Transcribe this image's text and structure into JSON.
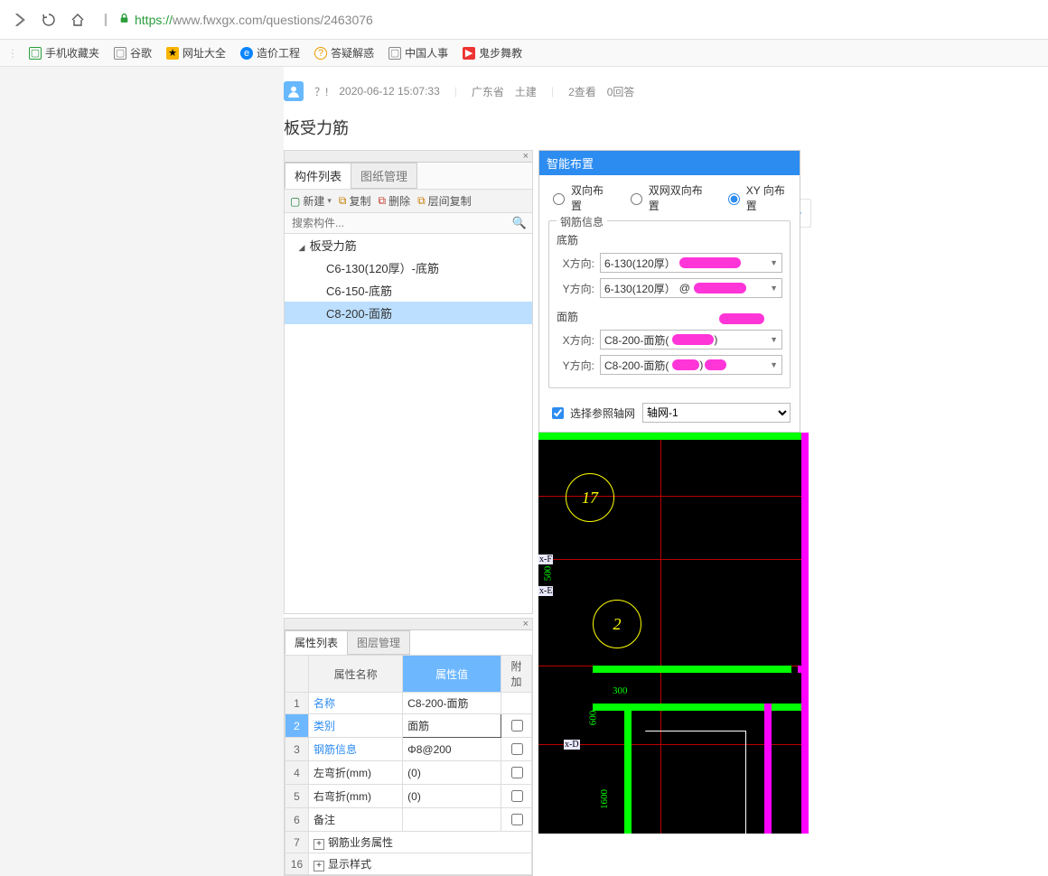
{
  "url": {
    "https": "https://",
    "rest": "www.fwxgx.com/questions/2463076"
  },
  "bookmarks": [
    {
      "label": "手机收藏夹",
      "icon": "phone"
    },
    {
      "label": "谷歌",
      "icon": "page"
    },
    {
      "label": "网址大全",
      "icon": "orange"
    },
    {
      "label": "造价工程",
      "icon": "blue"
    },
    {
      "label": "答疑解惑",
      "icon": "q"
    },
    {
      "label": "中国人事",
      "icon": "page"
    },
    {
      "label": "鬼步舞教",
      "icon": "red"
    }
  ],
  "post": {
    "author": "？!",
    "time": "2020-06-12 15:07:33",
    "region": "广东省",
    "category": "土建",
    "views": "2查看",
    "answers": "0回答",
    "title": "板受力筋"
  },
  "left_panel": {
    "tab1": "构件列表",
    "tab2": "图纸管理",
    "btn_new": "新建",
    "btn_copy": "复制",
    "btn_delete": "删除",
    "btn_level": "层间复制",
    "search_placeholder": "搜索构件...",
    "tree_root": "板受力筋",
    "items": [
      "C6-130(120厚）-底筋",
      "C6-150-底筋",
      "C8-200-面筋"
    ]
  },
  "smart_panel": {
    "title": "智能布置",
    "opt1": "双向布置",
    "opt2": "双网双向布置",
    "opt3": "XY 向布置",
    "legend": "钢筋信息",
    "sect_bottom": "底筋",
    "sect_top": "面筋",
    "lab_x": "X方向:",
    "lab_y": "Y方向:",
    "bottom_x": "6-130(120厚）",
    "bottom_y": "6-130(120厚）",
    "top_x": "C8-200-面筋(",
    "top_y": "C8-200-面筋(",
    "ref_grid_label": "选择参照轴网",
    "ref_grid_value": "轴网-1"
  },
  "prop_panel": {
    "tab1": "属性列表",
    "tab2": "图层管理",
    "col_name": "属性名称",
    "col_value": "属性值",
    "col_extra": "附加",
    "rows": [
      {
        "idx": "1",
        "name": "名称",
        "value": "C8-200-面筋",
        "link": true
      },
      {
        "idx": "2",
        "name": "类别",
        "value": "面筋",
        "link": true,
        "sel": true
      },
      {
        "idx": "3",
        "name": "钢筋信息",
        "value": "Φ8@200",
        "link": true
      },
      {
        "idx": "4",
        "name": "左弯折(mm)",
        "value": "(0)"
      },
      {
        "idx": "5",
        "name": "右弯折(mm)",
        "value": "(0)"
      },
      {
        "idx": "6",
        "name": "备注",
        "value": ""
      },
      {
        "idx": "7",
        "name": "钢筋业务属性",
        "value": "",
        "group": true
      },
      {
        "idx": "16",
        "name": "显示样式",
        "value": "",
        "group": true
      }
    ]
  },
  "cad": {
    "bubble17": "17",
    "bubble2": "2",
    "tag_f": "x-F",
    "tag_e": "x-E",
    "tag_d": "x-D",
    "dim300": "300",
    "dim500": "500",
    "dim600": "600",
    "dim1600": "1600"
  }
}
